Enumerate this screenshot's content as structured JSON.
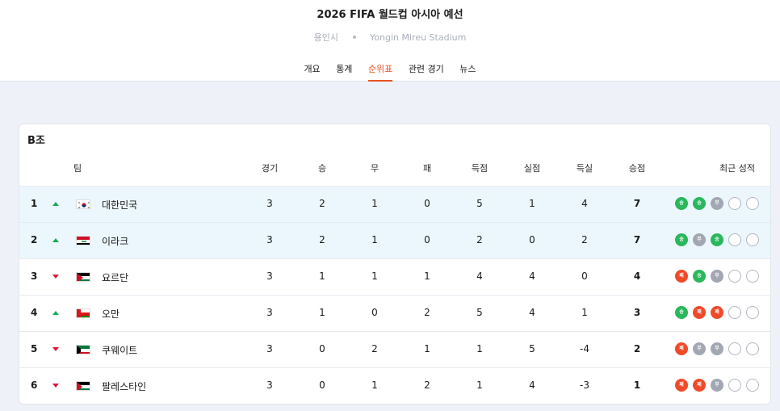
{
  "header": {
    "title": "2026 FIFA 월드컵 아시아 예선",
    "city": "용인시",
    "stadium": "Yongin Mireu Stadium"
  },
  "tabs": [
    {
      "label": "개요",
      "active": false
    },
    {
      "label": "통계",
      "active": false
    },
    {
      "label": "순위표",
      "active": true
    },
    {
      "label": "관련 경기",
      "active": false
    },
    {
      "label": "뉴스",
      "active": false
    }
  ],
  "colors": {
    "accent": "#e8541f",
    "win": "#2bb75c",
    "draw": "#a2a8b3",
    "loss": "#ee4b2b",
    "trend_up": "#18a957",
    "trend_down": "#d81b3c",
    "highlight_row": "#ebf7fd"
  },
  "standings": {
    "group": "B조",
    "headers": {
      "team": "팀",
      "played": "경기",
      "won": "승",
      "drawn": "무",
      "lost": "패",
      "gf": "득점",
      "ga": "실점",
      "gd": "득실",
      "pts": "승점",
      "form": "최근 성적"
    },
    "form_labels": {
      "W": "승",
      "D": "무",
      "L": "패"
    },
    "rows": [
      {
        "rank": "1",
        "trend": "up",
        "flag": "korea-flag-icon",
        "team": "대한민국",
        "played": "3",
        "won": "2",
        "drawn": "1",
        "lost": "0",
        "gf": "5",
        "ga": "1",
        "gd": "4",
        "pts": "7",
        "form": [
          "W",
          "W",
          "D",
          "E",
          "E"
        ],
        "highlight": true
      },
      {
        "rank": "2",
        "trend": "up",
        "flag": "iraq-flag-icon",
        "team": "이라크",
        "played": "3",
        "won": "2",
        "drawn": "1",
        "lost": "0",
        "gf": "2",
        "ga": "0",
        "gd": "2",
        "pts": "7",
        "form": [
          "W",
          "D",
          "W",
          "E",
          "E"
        ],
        "highlight": true
      },
      {
        "rank": "3",
        "trend": "down",
        "flag": "jordan-flag-icon",
        "team": "요르단",
        "played": "3",
        "won": "1",
        "drawn": "1",
        "lost": "1",
        "gf": "4",
        "ga": "4",
        "gd": "0",
        "pts": "4",
        "form": [
          "L",
          "W",
          "D",
          "E",
          "E"
        ],
        "highlight": false
      },
      {
        "rank": "4",
        "trend": "up",
        "flag": "oman-flag-icon",
        "team": "오만",
        "played": "3",
        "won": "1",
        "drawn": "0",
        "lost": "2",
        "gf": "5",
        "ga": "4",
        "gd": "1",
        "pts": "3",
        "form": [
          "W",
          "L",
          "L",
          "E",
          "E"
        ],
        "highlight": false
      },
      {
        "rank": "5",
        "trend": "down",
        "flag": "kuwait-flag-icon",
        "team": "쿠웨이트",
        "played": "3",
        "won": "0",
        "drawn": "2",
        "lost": "1",
        "gf": "1",
        "ga": "5",
        "gd": "-4",
        "pts": "2",
        "form": [
          "L",
          "D",
          "D",
          "E",
          "E"
        ],
        "highlight": false
      },
      {
        "rank": "6",
        "trend": "down",
        "flag": "palestine-flag-icon",
        "team": "팔레스타인",
        "played": "3",
        "won": "0",
        "drawn": "1",
        "lost": "2",
        "gf": "1",
        "ga": "4",
        "gd": "-3",
        "pts": "1",
        "form": [
          "L",
          "L",
          "D",
          "E",
          "E"
        ],
        "highlight": false
      }
    ]
  }
}
